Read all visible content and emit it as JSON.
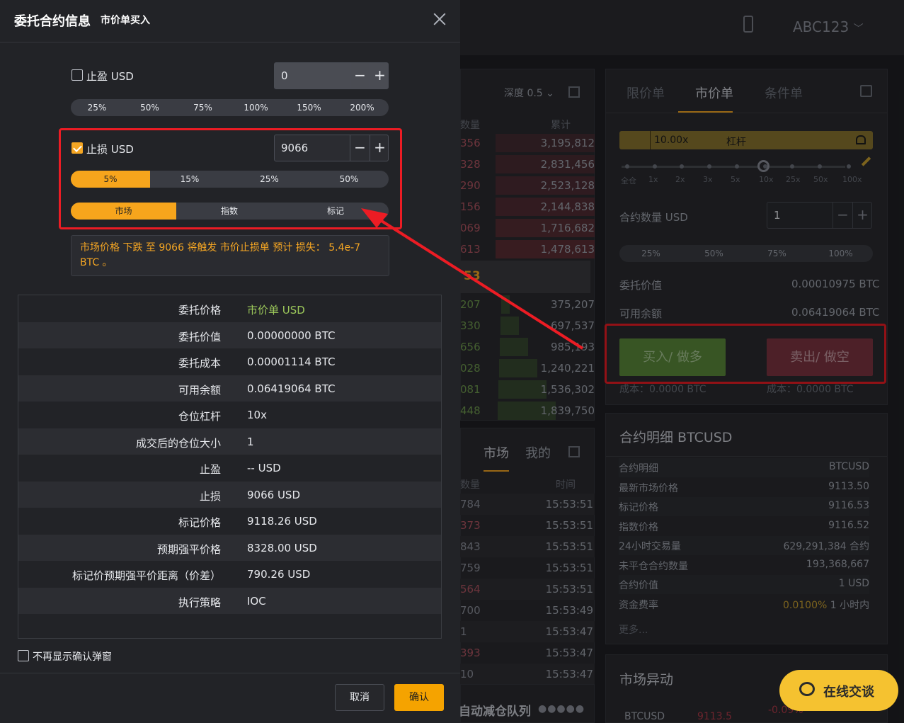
{
  "app": {
    "account": "ABC123",
    "depth_label": "深度 0.5",
    "orderbook": {
      "headers": [
        "数量",
        "累计"
      ],
      "asks": [
        {
          "qty": "356",
          "total": "3,195,812"
        },
        {
          "qty": "328",
          "total": "2,831,456"
        },
        {
          "qty": "290",
          "total": "2,523,128"
        },
        {
          "qty": "156",
          "total": "2,144,838"
        },
        {
          "qty": "069",
          "total": "1,716,682"
        },
        {
          "qty": "613",
          "total": "1,478,613"
        }
      ],
      "mid_price": "53",
      "bids": [
        {
          "qty": "207",
          "total": "375,207"
        },
        {
          "qty": "330",
          "total": "697,537"
        },
        {
          "qty": "656",
          "total": "985,193"
        },
        {
          "qty": "028",
          "total": "1,240,221"
        },
        {
          "qty": "081",
          "total": "1,536,302"
        },
        {
          "qty": "448",
          "total": "1,839,750"
        }
      ]
    },
    "trades": {
      "tab_market": "市场",
      "tab_mine": "我的",
      "headers": [
        "数量",
        "时间"
      ],
      "rows": [
        {
          "qty": "784",
          "time": "15:53:51"
        },
        {
          "qty": "373",
          "time": "15:53:51"
        },
        {
          "qty": "843",
          "time": "15:53:51"
        },
        {
          "qty": "759",
          "time": "15:53:51"
        },
        {
          "qty": "564",
          "time": "15:53:51"
        },
        {
          "qty": "700",
          "time": "15:53:49"
        },
        {
          "qty": "1",
          "time": "15:53:47"
        },
        {
          "qty": "393",
          "time": "15:53:47"
        },
        {
          "qty": "10",
          "time": "15:53:47"
        }
      ]
    },
    "adl_label": "自动减仓队列",
    "order_panel": {
      "tabs": [
        "限价单",
        "市价单",
        "条件单"
      ],
      "active_tab": 1,
      "leverage_value": "10.00x",
      "leverage_label": "杠杆",
      "leverage_ticks": [
        "全仓",
        "1x",
        "2x",
        "3x",
        "5x",
        "10x",
        "25x",
        "50x",
        "100x"
      ],
      "qty_label": "合约数量 USD",
      "qty_value": "1",
      "pct": [
        "25%",
        "50%",
        "75%",
        "100%"
      ],
      "order_value_label": "委托价值",
      "order_value": "0.00010975 BTC",
      "available_label": "可用余额",
      "available": "0.06419064 BTC",
      "buy_label": "买入/ 做多",
      "sell_label": "卖出/ 做空",
      "buy_cost": "成本：0.0000 BTC",
      "sell_cost": "成本：0.0000 BTC"
    },
    "contract_details": {
      "title": "合约明细 BTCUSD",
      "rows": [
        {
          "k": "合约明细",
          "v": "BTCUSD"
        },
        {
          "k": "最新市场价格",
          "v": "9113.50"
        },
        {
          "k": "标记价格",
          "v": "9116.53"
        },
        {
          "k": "指数价格",
          "v": "9116.52"
        },
        {
          "k": "24小时交易量",
          "v": "629,291,384 合约"
        },
        {
          "k": "未平仓合约数量",
          "v": "193,368,667"
        },
        {
          "k": "合约价值",
          "v": "1 USD"
        }
      ],
      "funding_label": "资金费率",
      "funding_rate": "0.0100%",
      "funding_period": "1 小时内",
      "more": "更多..."
    },
    "market_anomaly": {
      "title": "市场异动",
      "symbol": "BTCUSD",
      "price": "9113.5",
      "change": "-0.09%"
    },
    "chat_label": "在线交谈"
  },
  "modal": {
    "title": "委托合约信息",
    "subtitle": "市价单买入",
    "take_profit": {
      "label": "止盈  USD",
      "checked": false,
      "value": "0",
      "pct": [
        "25%",
        "50%",
        "75%",
        "100%",
        "150%",
        "200%"
      ]
    },
    "stop_loss": {
      "label": "止损  USD",
      "checked": true,
      "value": "9066",
      "pct": [
        "5%",
        "15%",
        "25%",
        "50%"
      ],
      "selected_pct": "5%",
      "trigger": [
        "市场",
        "指数",
        "标记"
      ],
      "selected_trigger": "市场"
    },
    "notice": "市场价格 下跌 至 9066 将触发 市价止损单 预计 损失： 5.4e-7 BTC 。",
    "rows": [
      {
        "k": "委托价格",
        "v": "市价单 USD"
      },
      {
        "k": "委托价值",
        "v": "0.00000000 BTC"
      },
      {
        "k": "委托成本",
        "v": "0.00001114 BTC"
      },
      {
        "k": "可用余额",
        "v": "0.06419064 BTC"
      },
      {
        "k": "仓位杠杆",
        "v": "10x"
      },
      {
        "k": "成交后的仓位大小",
        "v": "1"
      },
      {
        "k": "止盈",
        "v": "-- USD"
      },
      {
        "k": "止损",
        "v": "9066 USD"
      },
      {
        "k": "标记价格",
        "v": "9118.26 USD"
      },
      {
        "k": "预期强平价格",
        "v": "8328.00 USD"
      },
      {
        "k": "标记价预期强平价距离（价差）",
        "v": "790.26 USD"
      },
      {
        "k": "执行策略",
        "v": "IOC"
      }
    ],
    "dont_show": "不再显示确认弹窗",
    "cancel": "取消",
    "confirm": "确认"
  },
  "colors": {
    "accent": "#f5a623",
    "buy": "#5b8a3a",
    "sell": "#8a3a46",
    "highlight": "#ec1c24"
  }
}
